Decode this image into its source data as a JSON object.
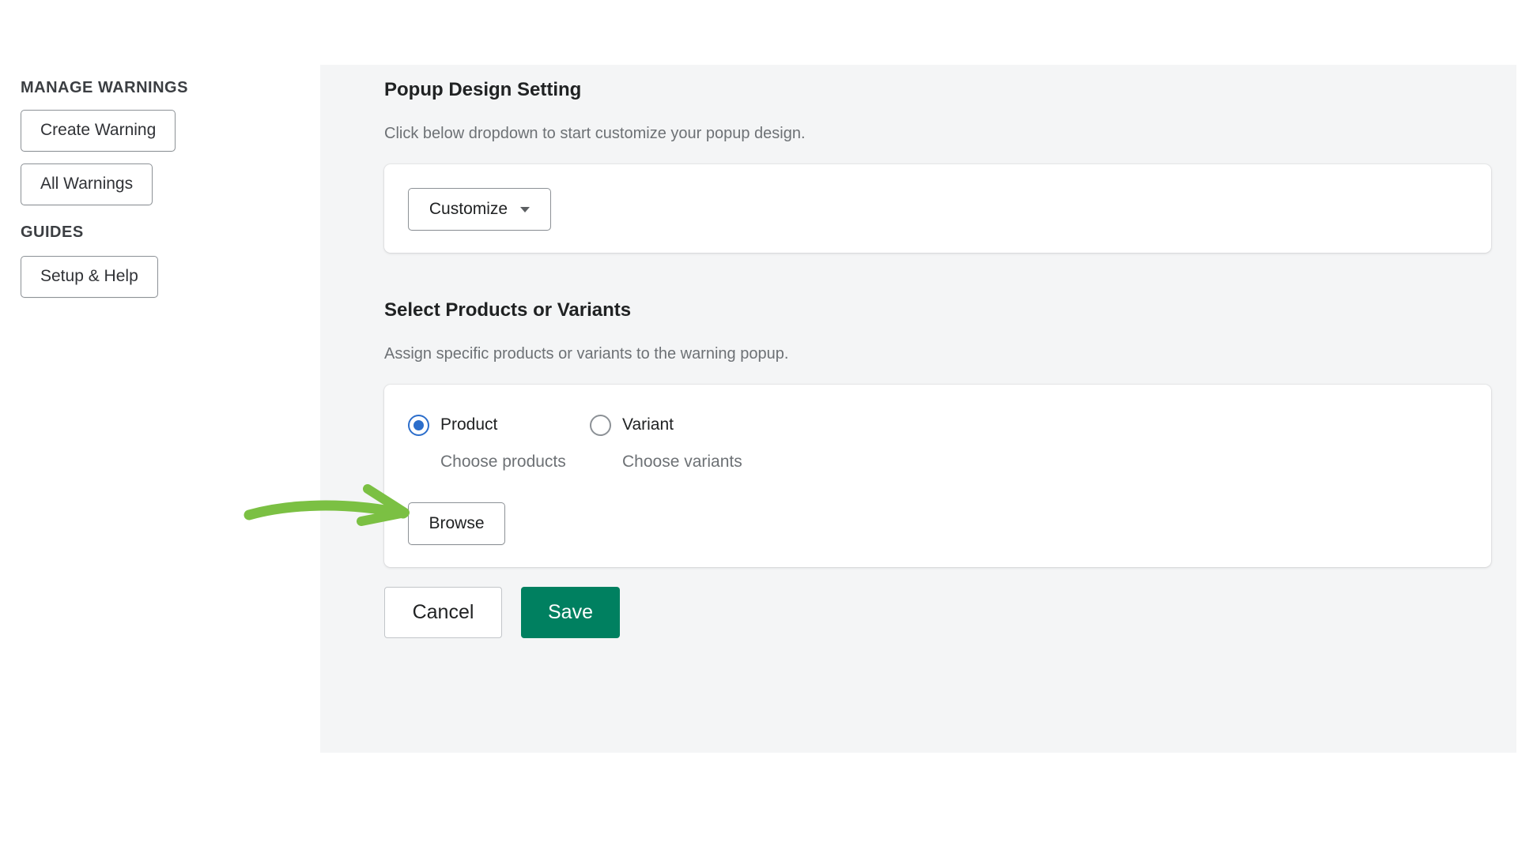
{
  "sidebar": {
    "manage_heading": "MANAGE WARNINGS",
    "create_warning": "Create Warning",
    "all_warnings": "All Warnings",
    "guides_heading": "GUIDES",
    "setup_help": "Setup & Help"
  },
  "popup_design": {
    "title": "Popup Design Setting",
    "description": "Click below dropdown to start customize your popup design.",
    "customize_label": "Customize"
  },
  "product_select": {
    "title": "Select Products or Variants",
    "description": "Assign specific products or variants to the warning popup.",
    "options": [
      {
        "label": "Product",
        "help": "Choose products",
        "checked": true
      },
      {
        "label": "Variant",
        "help": "Choose variants",
        "checked": false
      }
    ],
    "browse_label": "Browse"
  },
  "actions": {
    "cancel_label": "Cancel",
    "save_label": "Save"
  },
  "colors": {
    "primary": "#008060",
    "radio_accent": "#2c6ecb",
    "arrow": "#7bc043",
    "panel_bg": "#f4f5f6"
  },
  "icons": {
    "dropdown": "caret-down-icon",
    "pointer": "arrow-right-icon"
  }
}
